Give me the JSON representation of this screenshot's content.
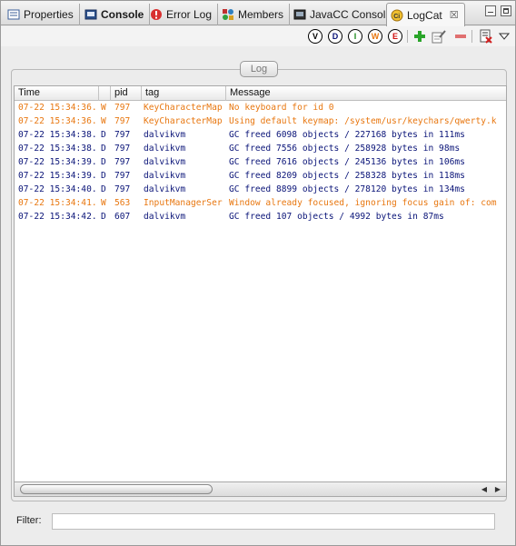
{
  "tabs": [
    {
      "label": "Properties",
      "icon": "properties-icon",
      "active": false
    },
    {
      "label": "Console",
      "icon": "console-icon",
      "active": false,
      "bold": true
    },
    {
      "label": "Error Log",
      "icon": "error-log-icon",
      "active": false
    },
    {
      "label": "Members",
      "icon": "members-icon",
      "active": false
    },
    {
      "label": "JavaCC Consol",
      "icon": "javacc-console-icon",
      "active": false
    },
    {
      "label": "LogCat",
      "icon": "logcat-icon",
      "active": true,
      "close": "☒"
    }
  ],
  "toolbar": {
    "levels": [
      {
        "letter": "V",
        "name": "verbose",
        "color": "#000000"
      },
      {
        "letter": "D",
        "name": "debug",
        "color": "#0a1478"
      },
      {
        "letter": "I",
        "name": "info",
        "color": "#1a8a1a"
      },
      {
        "letter": "W",
        "name": "warning",
        "color": "#e87710"
      },
      {
        "letter": "E",
        "name": "error",
        "color": "#d01010"
      }
    ],
    "icons": [
      "add-filter-icon",
      "edit-filter-icon",
      "remove-filter-icon",
      "clear-log-icon",
      "view-menu-icon"
    ]
  },
  "group": {
    "label": "Log"
  },
  "table": {
    "columns": [
      "Time",
      "",
      "pid",
      "tag",
      "Message"
    ],
    "rows": [
      {
        "time": "07-22 15:34:36.",
        "level": "W",
        "pid": "797",
        "tag": "KeyCharacterMap",
        "message": "No keyboard for id 0",
        "kind": "warn"
      },
      {
        "time": "07-22 15:34:36.",
        "level": "W",
        "pid": "797",
        "tag": "KeyCharacterMap",
        "message": "Using default keymap: /system/usr/keychars/qwerty.k",
        "kind": "warn"
      },
      {
        "time": "07-22 15:34:38.",
        "level": "D",
        "pid": "797",
        "tag": "dalvikvm",
        "message": "GC freed 6098 objects / 227168 bytes in 111ms",
        "kind": "debug"
      },
      {
        "time": "07-22 15:34:38.",
        "level": "D",
        "pid": "797",
        "tag": "dalvikvm",
        "message": "GC freed 7556 objects / 258928 bytes in 98ms",
        "kind": "debug"
      },
      {
        "time": "07-22 15:34:39.",
        "level": "D",
        "pid": "797",
        "tag": "dalvikvm",
        "message": "GC freed 7616 objects / 245136 bytes in 106ms",
        "kind": "debug"
      },
      {
        "time": "07-22 15:34:39.",
        "level": "D",
        "pid": "797",
        "tag": "dalvikvm",
        "message": "GC freed 8209 objects / 258328 bytes in 118ms",
        "kind": "debug"
      },
      {
        "time": "07-22 15:34:40.",
        "level": "D",
        "pid": "797",
        "tag": "dalvikvm",
        "message": "GC freed 8899 objects / 278120 bytes in 134ms",
        "kind": "debug"
      },
      {
        "time": "07-22 15:34:41.",
        "level": "W",
        "pid": "563",
        "tag": "InputManagerSer",
        "message": "Window already focused, ignoring focus gain of: com",
        "kind": "warn"
      },
      {
        "time": "07-22 15:34:42.",
        "level": "D",
        "pid": "607",
        "tag": "dalvikvm",
        "message": "GC freed 107 objects / 4992 bytes in 87ms",
        "kind": "debug"
      }
    ]
  },
  "filter": {
    "label": "Filter:",
    "value": "",
    "placeholder": ""
  },
  "colors": {
    "warn": "#e87710",
    "debug": "#0a1478",
    "add": "#2aa52a",
    "remove": "#e05050"
  }
}
